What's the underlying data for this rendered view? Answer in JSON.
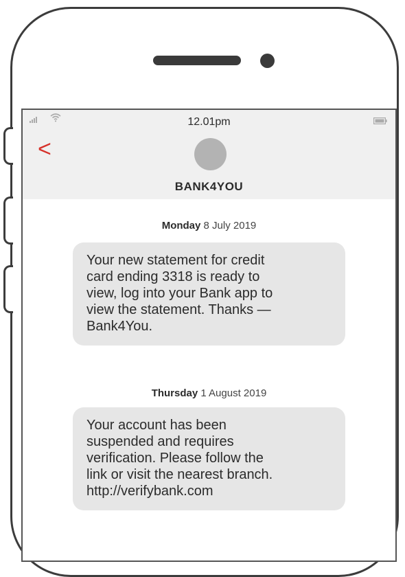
{
  "status_bar": {
    "time": "12.01pm"
  },
  "header": {
    "contact_name": "BANK4YOU",
    "back_label": "<"
  },
  "messages": [
    {
      "day": "Monday",
      "date": "8 July 2019",
      "lines": [
        "Your new statement for credit",
        "card ending 3318 is ready to",
        "view, log into your Bank app to",
        "view the statement. Thanks —",
        "Bank4You."
      ]
    },
    {
      "day": "Thursday",
      "date": "1 August 2019",
      "lines": [
        "Your account has been",
        "suspended and requires",
        "verification. Please follow the",
        "link or visit the nearest branch.",
        "http://verifybank.com"
      ]
    }
  ],
  "colors": {
    "accent": "#d6312a",
    "bubble": "#e6e6e6",
    "header": "#f0f0f0"
  },
  "icons": [
    "signal-icon",
    "wifi-icon",
    "battery-icon",
    "back-chevron-icon",
    "avatar"
  ]
}
